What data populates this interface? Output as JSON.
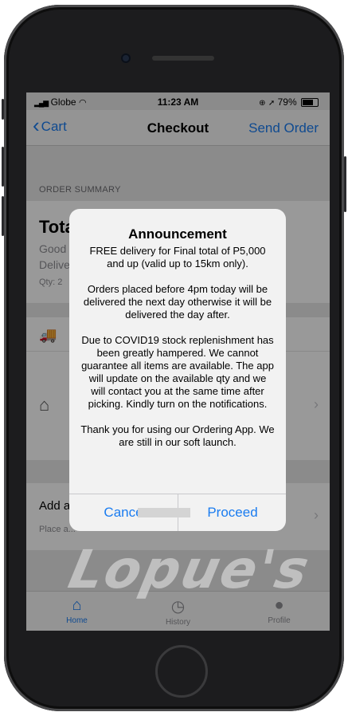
{
  "status_bar": {
    "carrier": "Globe",
    "time": "11:23 AM",
    "battery": "79%",
    "battery_level": 0.79
  },
  "nav": {
    "back_label": "Cart",
    "title": "Checkout",
    "action_label": "Send Order"
  },
  "order_summary": {
    "header": "ORDER SUMMARY",
    "total_label": "Tota",
    "line1": "Good",
    "line2": "Delive",
    "qty": "Qty: 2"
  },
  "instructions": {
    "label": "Add a",
    "hint": "Place a..."
  },
  "alert": {
    "title": "Announcement",
    "body": "FREE delivery for Final total of P5,000 and up (valid up to 15km only).\n\nOrders placed before 4pm today will be delivered the next day otherwise it will be delivered the day after.\n\nDue to COVID19 stock replenishment has been greatly hampered. We cannot guarantee all items are available. The app will update on the available qty and we will contact you at the same time after picking. Kindly turn on the notifications.\n\nThank you for using our Ordering App. We are still in our soft launch.",
    "cancel_label": "Cance",
    "proceed_label": "Proceed"
  },
  "tabs": [
    {
      "label": "Home",
      "icon": "home-icon",
      "active": true
    },
    {
      "label": "History",
      "icon": "history-icon",
      "active": false
    },
    {
      "label": "Profile",
      "icon": "profile-icon",
      "active": false
    }
  ],
  "watermark": "Lopue's",
  "colors": {
    "accent": "#1a7cf0",
    "alert_bg": "#f2f2f2",
    "frame": "#1c1c1e"
  }
}
